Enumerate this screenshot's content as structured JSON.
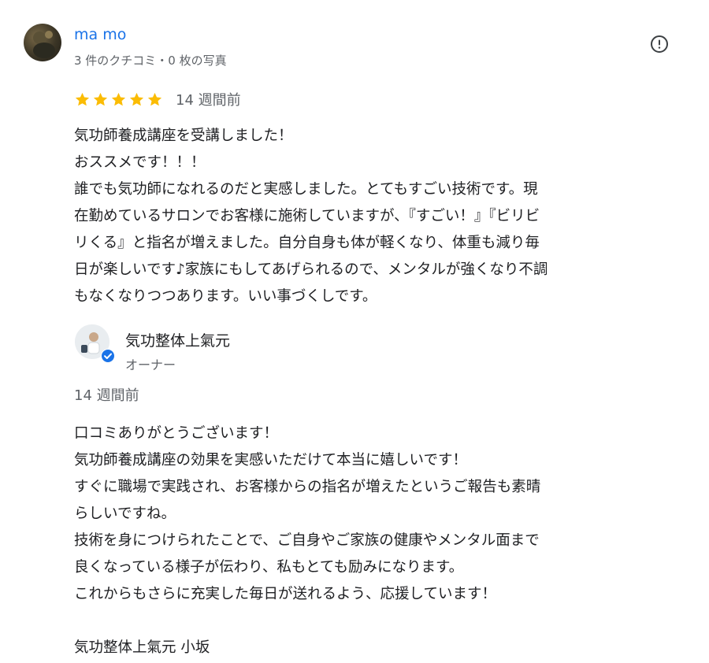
{
  "review": {
    "reviewer_name": "ma mo",
    "reviewer_meta": "3 件のクチコミ・0 枚の写真",
    "rating": 5,
    "time": "14 週間前",
    "text_lines": [
      "気功師養成講座を受講しました！",
      "おススメです！！！",
      "誰でも気功師になれるのだと実感しました。とてもすごい技術です。現",
      "在勤めているサロンでお客様に施術していますが、『すごい！』『ビリビ",
      "リくる』と指名が増えました。自分自身も体が軽くなり、体重も減り毎",
      "日が楽しいです♪家族にもしてあげられるので、メンタルが強くなり不調",
      "もなくなりつつあります。いい事づくしです。"
    ]
  },
  "owner_reply": {
    "owner_name": "気功整体上氣元",
    "owner_role": "オーナー",
    "time": "14 週間前",
    "text_lines": [
      "口コミありがとうございます！",
      "気功師養成講座の効果を実感いただけて本当に嬉しいです！",
      "すぐに職場で実践され、お客様からの指名が増えたというご報告も素晴",
      "らしいですね。",
      "技術を身につけられたことで、ご自身やご家族の健康やメンタル面まで",
      "良くなっている様子が伝わり、私もとても励みになります。",
      "これからもさらに充実した毎日が送れるよう、応援しています！",
      "",
      "気功整体上氣元 小坂"
    ]
  },
  "colors": {
    "link_blue": "#1a73e8",
    "star_gold": "#fbbc04",
    "secondary_text": "#5f6368",
    "verified_blue": "#1a73e8"
  },
  "icons": {
    "report": "report-icon",
    "star": "star-icon",
    "verified": "verified-badge-icon"
  }
}
